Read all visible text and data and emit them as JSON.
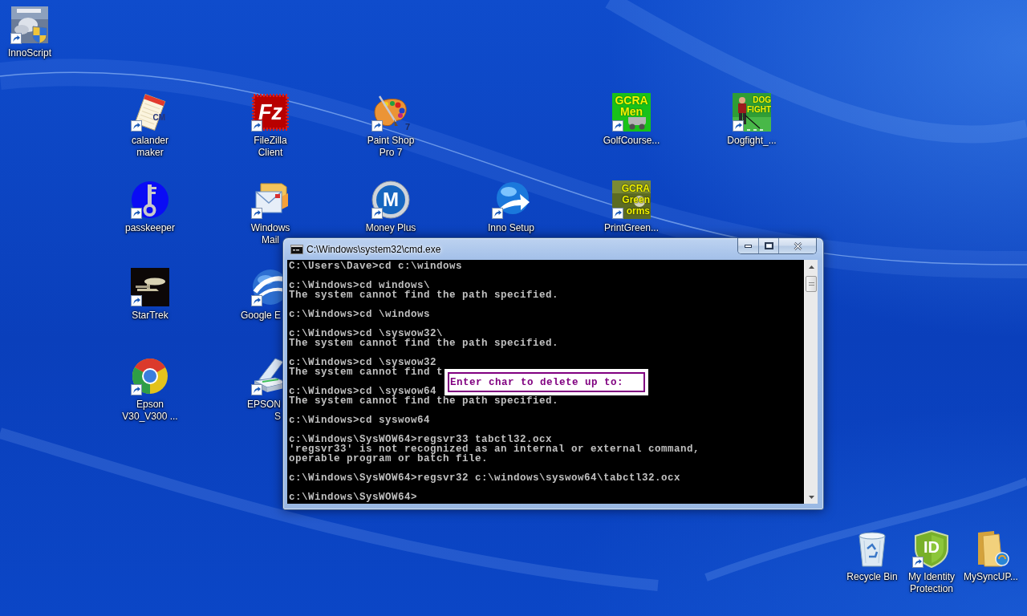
{
  "desktop_icons": [
    {
      "label": "InnoScript",
      "kind": "photo_shield",
      "shortcut": true
    },
    {
      "label": "calander maker",
      "kind": "notepad",
      "shortcut": true,
      "icon_text": [
        "CM"
      ]
    },
    {
      "label": "FileZilla Client",
      "kind": "stamp",
      "shortcut": true,
      "icon_text": [
        "Fz"
      ]
    },
    {
      "label": "Paint Shop Pro 7",
      "kind": "palette",
      "shortcut": true,
      "icon_text": [
        "7"
      ]
    },
    {
      "label": "GolfCourse...",
      "kind": "tile",
      "shortcut": true,
      "icon_text": [
        "GCRA",
        "Men"
      ]
    },
    {
      "label": "Dogfight_...",
      "kind": "golfer_tile",
      "shortcut": true,
      "icon_text": [
        "DOG",
        "FIGHT"
      ]
    },
    {
      "label": "passkeeper",
      "kind": "key",
      "shortcut": true
    },
    {
      "label": "Windows Mail",
      "kind": "mail",
      "shortcut": true
    },
    {
      "label": "Money Plus",
      "kind": "ring",
      "shortcut": true,
      "icon_text": [
        "M"
      ]
    },
    {
      "label": "Inno Setup",
      "kind": "globe_arrow",
      "shortcut": true
    },
    {
      "label": "PrintGreen...",
      "kind": "photo_tile",
      "shortcut": true,
      "icon_text": [
        "GCRA",
        "Green",
        "orms"
      ]
    },
    {
      "label": "StarTrek",
      "kind": "starship",
      "shortcut": true
    },
    {
      "label": "Google E",
      "kind": "globe",
      "shortcut": true
    },
    {
      "label": "Epson V30_V300 ...",
      "kind": "wheel",
      "shortcut": true
    },
    {
      "label": "EPSON S",
      "kind": "scanner",
      "shortcut": true
    },
    {
      "label": "Recycle Bin",
      "kind": "bin",
      "shortcut": false
    },
    {
      "label": "My Identity Protection",
      "kind": "shield",
      "shortcut": true,
      "icon_text": [
        "ID"
      ]
    },
    {
      "label": "MySyncUP...",
      "kind": "folder",
      "shortcut": false
    }
  ],
  "console_window": {
    "title": "C:\\Windows\\system32\\cmd.exe",
    "output_blocks": [
      [
        "C:\\Users\\Dave>cd c:\\windows"
      ],
      [
        "c:\\Windows>cd windows\\",
        "The system cannot find the path specified."
      ],
      [
        "c:\\Windows>cd \\windows"
      ],
      [
        "c:\\Windows>cd \\syswow32\\",
        "The system cannot find the path specified."
      ],
      [
        "c:\\Windows>cd \\syswow32",
        "The system cannot find t"
      ],
      [
        "c:\\Windows>cd \\syswow64",
        "The system cannot find the path specified."
      ],
      [
        "c:\\Windows>cd syswow64"
      ],
      [
        "c:\\Windows\\SysWOW64>regsvr33 tabctl32.ocx",
        "'regsvr33' is not recognized as an internal or external command,",
        "operable program or batch file."
      ],
      [
        "c:\\Windows\\SysWOW64>regsvr32 c:\\windows\\syswow64\\tabctl32.ocx"
      ],
      [
        "c:\\Windows\\SysWOW64>"
      ]
    ],
    "popup": {
      "prompt": "Enter char to delete up to:"
    }
  }
}
